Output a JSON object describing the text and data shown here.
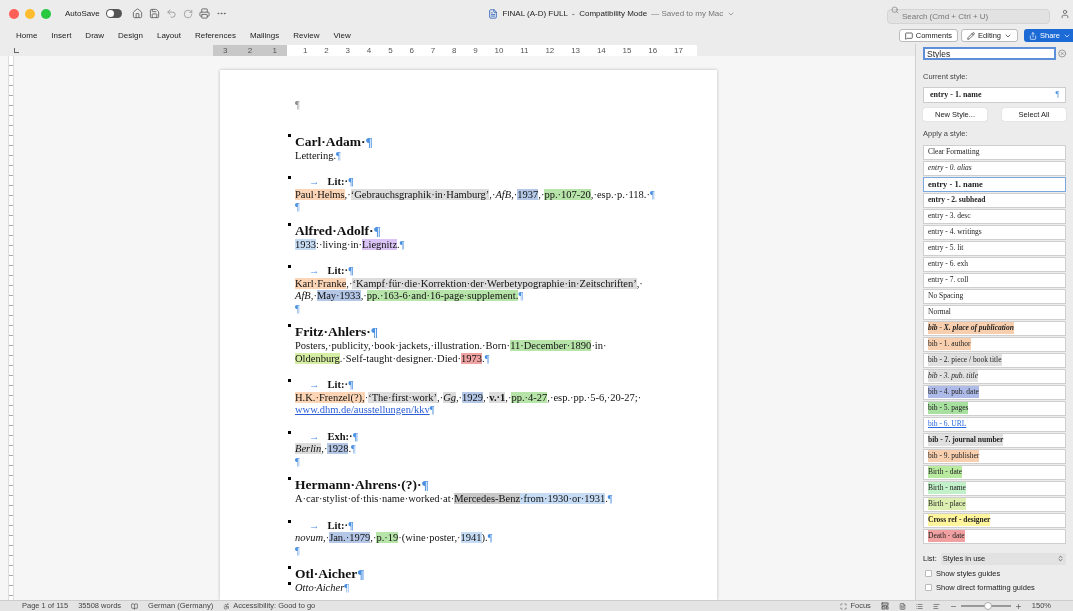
{
  "window": {
    "title": "FINAL (A-D) FULL  -  Compatibility Mode",
    "save_status": "— Saved to my Mac"
  },
  "autosave": {
    "label": "AutoSave",
    "on": false
  },
  "search": {
    "placeholder": "Search (Cmd + Ctrl + U)"
  },
  "menu": [
    "Home",
    "Insert",
    "Draw",
    "Design",
    "Layout",
    "References",
    "Mailings",
    "Review",
    "View"
  ],
  "toolbar_buttons": {
    "comments": "Comments",
    "editing": "Editing",
    "share": "Share"
  },
  "ruler": {
    "left_numbers": [
      "3",
      "2",
      "1"
    ],
    "numbers": [
      "1",
      "2",
      "3",
      "4",
      "5",
      "6",
      "7",
      "8",
      "9",
      "10",
      "11",
      "12",
      "13",
      "14",
      "15",
      "16",
      "17"
    ]
  },
  "document": {
    "paragraphs": [
      {
        "kind": "empty",
        "marked": false,
        "lines": [
          [
            {
              "t": "¶",
              "kind": "pilcrow_gray"
            }
          ]
        ]
      },
      {
        "kind": "name",
        "marked": true,
        "lines": [
          [
            {
              "t": "Carl·Adam·"
            },
            {
              "t": "¶",
              "kind": "pilcrow"
            }
          ]
        ]
      },
      {
        "kind": "body",
        "marked": false,
        "lines": [
          [
            {
              "t": "Lettering."
            },
            {
              "t": "¶",
              "kind": "pilcrow"
            }
          ]
        ]
      },
      {
        "kind": "lit",
        "marked": true,
        "lines": [
          [
            {
              "t": "→",
              "kind": "tab"
            },
            {
              "t": "Lit:·"
            },
            {
              "t": "¶",
              "kind": "pilcrow"
            }
          ]
        ]
      },
      {
        "kind": "body",
        "marked": false,
        "lines": [
          [
            {
              "t": "Paul·Helms",
              "color": "#fbd5b5"
            },
            {
              "t": ",·"
            },
            {
              "t": "‘Gebrauchsgraphik·in·Hamburg’",
              "color": "#dcdcdc"
            },
            {
              "t": ",·"
            },
            {
              "t": "AfB",
              "i": true
            },
            {
              "t": ",·"
            },
            {
              "t": "1937",
              "color": "#b4c7e7"
            },
            {
              "t": ",·"
            },
            {
              "t": "pp.·107-20",
              "color": "#b7e4a8"
            },
            {
              "t": ",·esp.·p.·118.·"
            },
            {
              "t": "¶",
              "kind": "pilcrow"
            }
          ]
        ]
      },
      {
        "kind": "empty",
        "marked": false,
        "lines": [
          [
            {
              "t": "¶",
              "kind": "pilcrow"
            }
          ]
        ]
      },
      {
        "kind": "name",
        "marked": true,
        "lines": [
          [
            {
              "t": "Alfred·Adolf·"
            },
            {
              "t": "¶",
              "kind": "pilcrow"
            }
          ]
        ]
      },
      {
        "kind": "body",
        "marked": false,
        "lines": [
          [
            {
              "t": "1933",
              "color": "#c6dcf4"
            },
            {
              "t": ":·living·in·"
            },
            {
              "t": "Liegnitz",
              "color": "#dcc3f5"
            },
            {
              "t": "."
            },
            {
              "t": "¶",
              "kind": "pilcrow"
            }
          ]
        ]
      },
      {
        "kind": "lit",
        "marked": true,
        "lines": [
          [
            {
              "t": "→",
              "kind": "tab"
            },
            {
              "t": "Lit:·"
            },
            {
              "t": "¶",
              "kind": "pilcrow"
            }
          ]
        ]
      },
      {
        "kind": "body",
        "marked": false,
        "lines": [
          [
            {
              "t": "Karl·Franke",
              "color": "#fbd5b5"
            },
            {
              "t": ",·"
            },
            {
              "t": "‘Kampf·für·die·Korrektion·der·Werbetypographie·in·Zeitschriften’",
              "color": "#dcdcdc"
            },
            {
              "t": ",·"
            }
          ],
          [
            {
              "t": "AfB",
              "i": true
            },
            {
              "t": ",·"
            },
            {
              "t": "May·1933",
              "color": "#b4c7e7"
            },
            {
              "t": ",·"
            },
            {
              "t": "pp.·163-6·and·16-page·supplement.",
              "color": "#b7e4a8"
            },
            {
              "t": "¶",
              "kind": "pilcrow"
            }
          ]
        ]
      },
      {
        "kind": "empty",
        "marked": false,
        "lines": [
          [
            {
              "t": "¶",
              "kind": "pilcrow"
            }
          ]
        ]
      },
      {
        "kind": "name",
        "marked": true,
        "lines": [
          [
            {
              "t": "Fritz·Ahlers·"
            },
            {
              "t": "¶",
              "kind": "pilcrow"
            }
          ]
        ]
      },
      {
        "kind": "body",
        "marked": false,
        "lines": [
          [
            {
              "t": "Posters,·publicity,·book·jackets,·illustration.·Born·"
            },
            {
              "t": "11·December·1890",
              "color": "#b7e4a8"
            },
            {
              "t": "·in·"
            }
          ],
          [
            {
              "t": "Oldenburg",
              "color": "#d6eea4"
            },
            {
              "t": ".·Self-taught·designer.·Died·"
            },
            {
              "t": "1973",
              "color": "#f0a3a3"
            },
            {
              "t": "."
            },
            {
              "t": "¶",
              "kind": "pilcrow"
            }
          ]
        ]
      },
      {
        "kind": "lit",
        "marked": true,
        "lines": [
          [
            {
              "t": "→",
              "kind": "tab"
            },
            {
              "t": "Lit:·"
            },
            {
              "t": "¶",
              "kind": "pilcrow"
            }
          ]
        ]
      },
      {
        "kind": "body",
        "marked": false,
        "lines": [
          [
            {
              "t": "H.K.·Frenzel(?),",
              "color": "#fbd5b5"
            },
            {
              "t": "·"
            },
            {
              "t": "‘The·first·work’",
              "color": "#dcdcdc"
            },
            {
              "t": ",·"
            },
            {
              "t": "Gg",
              "i": true,
              "color": "#dcdcdc"
            },
            {
              "t": ",·"
            },
            {
              "t": "1929",
              "color": "#b4c7e7"
            },
            {
              "t": ",·"
            },
            {
              "t": "v.·1",
              "b": true,
              "color": "#dcdcdc"
            },
            {
              "t": ",·"
            },
            {
              "t": "pp.·4-27",
              "color": "#b7e4a8"
            },
            {
              "t": ",·esp.·pp.·5-6,·20-27;·"
            }
          ],
          [
            {
              "t": "www.dhm.de/ausstellungen/kkv",
              "kind": "link"
            },
            {
              "t": "¶",
              "kind": "pilcrow"
            }
          ]
        ]
      },
      {
        "kind": "lit",
        "marked": true,
        "lines": [
          [
            {
              "t": "→",
              "kind": "tab"
            },
            {
              "t": "Exh:·"
            },
            {
              "t": "¶",
              "kind": "pilcrow"
            }
          ]
        ]
      },
      {
        "kind": "body",
        "marked": false,
        "lines": [
          [
            {
              "t": "Berlin",
              "i": true,
              "color": "#dcdcdc"
            },
            {
              "t": ",·"
            },
            {
              "t": "1928",
              "color": "#b4c7e7"
            },
            {
              "t": "."
            },
            {
              "t": "¶",
              "kind": "pilcrow"
            }
          ]
        ]
      },
      {
        "kind": "empty",
        "marked": false,
        "lines": [
          [
            {
              "t": "¶",
              "kind": "pilcrow"
            }
          ]
        ]
      },
      {
        "kind": "name",
        "marked": true,
        "lines": [
          [
            {
              "t": "Hermann·Ahrens·(?)·"
            },
            {
              "t": "¶",
              "kind": "pilcrow"
            }
          ]
        ]
      },
      {
        "kind": "body",
        "marked": false,
        "lines": [
          [
            {
              "t": "A·car·stylist·of·this·name·worked·at·"
            },
            {
              "t": "Mercedes-Benz",
              "color": "#c8c8c8"
            },
            {
              "t": "·from·1930·or·1931",
              "color": "#c6dcf4"
            },
            {
              "t": "."
            },
            {
              "t": "¶",
              "kind": "pilcrow"
            }
          ]
        ]
      },
      {
        "kind": "lit",
        "marked": true,
        "lines": [
          [
            {
              "t": "→",
              "kind": "tab"
            },
            {
              "t": "Lit:·"
            },
            {
              "t": "¶",
              "kind": "pilcrow"
            }
          ]
        ]
      },
      {
        "kind": "body",
        "marked": false,
        "lines": [
          [
            {
              "t": "novum",
              "i": true
            },
            {
              "t": ",·"
            },
            {
              "t": "Jan.·1979",
              "color": "#b4c7e7"
            },
            {
              "t": ",·"
            },
            {
              "t": "p.·19",
              "color": "#b7e4a8"
            },
            {
              "t": "·(wine·poster,·"
            },
            {
              "t": "1941",
              "color": "#c6dcf4"
            },
            {
              "t": ")."
            },
            {
              "t": "¶",
              "kind": "pilcrow"
            }
          ]
        ]
      },
      {
        "kind": "empty",
        "marked": false,
        "lines": [
          [
            {
              "t": "¶",
              "kind": "pilcrow"
            }
          ]
        ]
      },
      {
        "kind": "name",
        "marked": true,
        "lines": [
          [
            {
              "t": "Otl·Aicher"
            },
            {
              "t": "¶",
              "kind": "pilcrow"
            }
          ]
        ]
      },
      {
        "kind": "body",
        "marked": true,
        "lines": [
          [
            {
              "t": "Otto·Aicher",
              "i": true
            },
            {
              "t": "¶",
              "kind": "pilcrow"
            }
          ]
        ]
      }
    ]
  },
  "styles_pane": {
    "search_value": "Styles",
    "current_style_label": "Current style:",
    "current_style": "entry - 1. name",
    "current_style_mark": "¶",
    "buttons": [
      "New Style...",
      "Select All"
    ],
    "apply_label": "Apply a style:",
    "styles": [
      {
        "label": "Clear Formatting",
        "kind": "plain",
        "selected": false
      },
      {
        "label": "entry - 0. alias",
        "kind": "italic",
        "selected": false
      },
      {
        "label": "entry - 1. name",
        "kind": "bold",
        "selected": true
      },
      {
        "label": "entry - 2. subhead",
        "kind": "bold",
        "selected": false
      },
      {
        "label": "entry - 3. desc",
        "kind": "plain",
        "selected": false
      },
      {
        "label": "entry - 4. writings",
        "kind": "plain",
        "selected": false
      },
      {
        "label": "entry - 5. lit",
        "kind": "plain",
        "selected": false
      },
      {
        "label": "entry - 6. exh",
        "kind": "plain",
        "selected": false
      },
      {
        "label": "entry - 7. coll",
        "kind": "plain",
        "selected": false
      },
      {
        "label": "No Spacing",
        "kind": "plain",
        "selected": false
      },
      {
        "label": "Normal",
        "kind": "plain",
        "selected": false
      },
      {
        "label": "bib - X. place of publication",
        "kind": "bold-italic",
        "color": "#f8cfae",
        "selected": false
      },
      {
        "label": "bib - 1. author",
        "kind": "plain",
        "color": "#f8cfae",
        "selected": false
      },
      {
        "label": "bib - 2. piece / book title",
        "kind": "plain",
        "color": "#e0e0e0",
        "selected": false
      },
      {
        "label": "bib - 3. pub. title",
        "kind": "italic",
        "color": "#e0e0e0",
        "selected": false
      },
      {
        "label": "bib - 4. pub. date",
        "kind": "plain",
        "color": "#aebbe8",
        "selected": false
      },
      {
        "label": "bib - 5. pages",
        "kind": "plain",
        "color": "#a8e0a0",
        "selected": false
      },
      {
        "label": "bib - 6. URL",
        "kind": "link",
        "selected": false
      },
      {
        "label": "bib - 7. journal number",
        "kind": "bold",
        "color": "#e0e0e0",
        "selected": false
      },
      {
        "label": "bib - 9. publisher",
        "kind": "plain",
        "color": "#f8cfae",
        "selected": false
      },
      {
        "label": "Birth - date",
        "kind": "plain",
        "color": "#b8eaa0",
        "selected": false
      },
      {
        "label": "Birth - name",
        "kind": "plain",
        "color": "#c2f0c8",
        "selected": false
      },
      {
        "label": "Birth - place",
        "kind": "plain",
        "color": "#dcefb0",
        "selected": false
      },
      {
        "label": "Cross ref - designer",
        "kind": "bold",
        "color": "#fff59d",
        "selected": false
      },
      {
        "label": "Death - date",
        "kind": "plain",
        "color": "#f0a0a0",
        "selected": false
      }
    ],
    "list_label": "List:",
    "list_value": "Styles in use",
    "options": [
      {
        "label": "Show styles guides",
        "checked": false
      },
      {
        "label": "Show direct formatting guides",
        "checked": false
      }
    ]
  },
  "status_bar": {
    "page": "Page 1 of 115",
    "words": "35508 words",
    "language": "German (Germany)",
    "accessibility": "Accessibility: Good to go",
    "focus": "Focus",
    "zoom": {
      "level": 0.55,
      "reading": "150%"
    }
  }
}
